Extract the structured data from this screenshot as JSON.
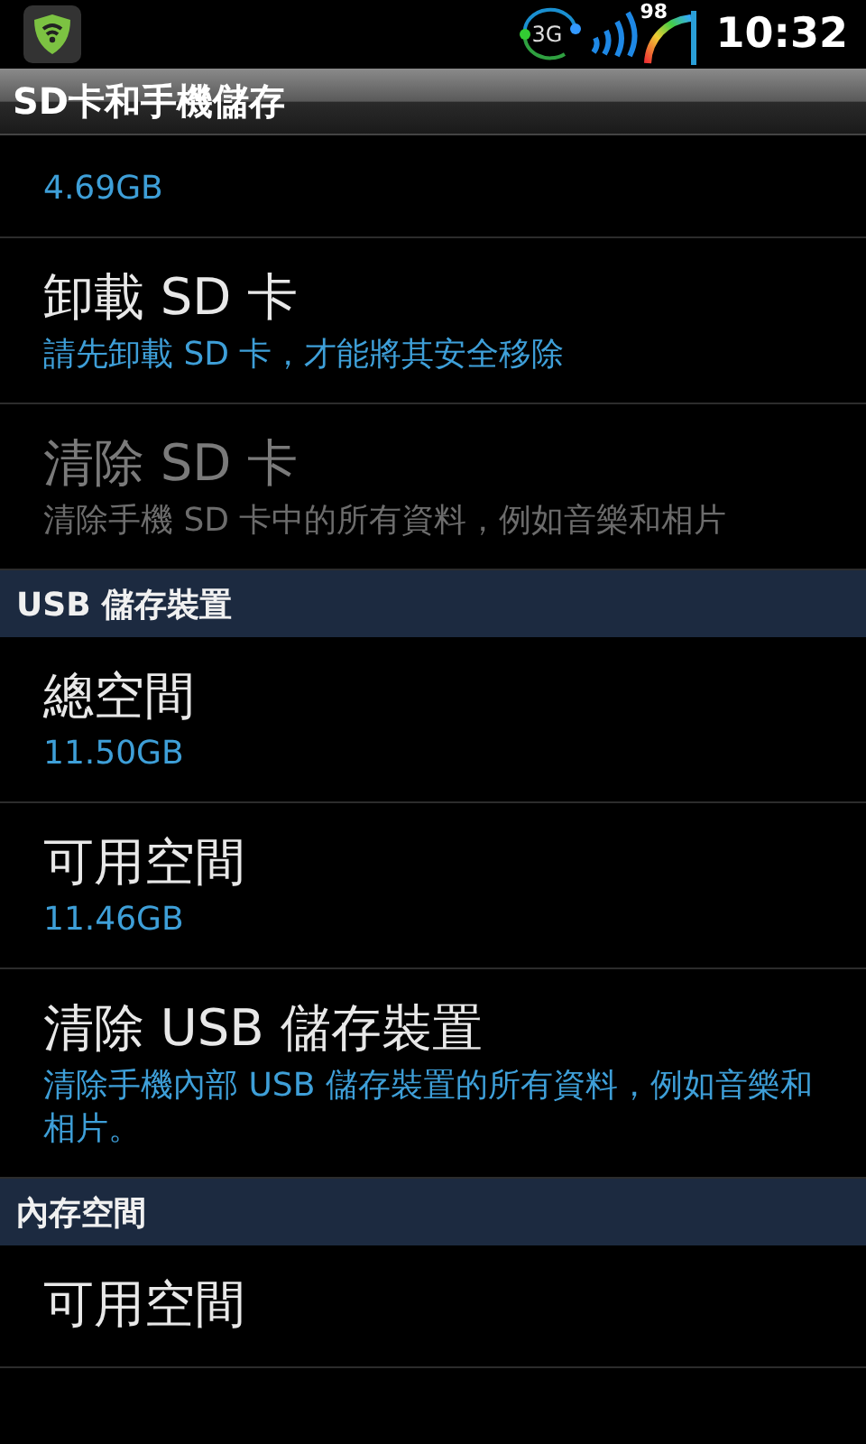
{
  "status_bar": {
    "network": "3G",
    "battery": "98",
    "time": "10:32"
  },
  "title_bar": {
    "title": "SD卡和手機儲存"
  },
  "list": [
    {
      "kind": "item",
      "summary": "4.69GB",
      "disabled": false
    },
    {
      "kind": "item",
      "title": "卸載 SD 卡",
      "summary": "請先卸載 SD 卡，才能將其安全移除",
      "disabled": false
    },
    {
      "kind": "item",
      "title": "清除 SD 卡",
      "summary": "清除手機 SD 卡中的所有資料，例如音樂和相片",
      "disabled": true
    },
    {
      "kind": "header",
      "title": "USB 儲存裝置"
    },
    {
      "kind": "item",
      "title": "總空間",
      "summary": "11.50GB",
      "disabled": false
    },
    {
      "kind": "item",
      "title": "可用空間",
      "summary": "11.46GB",
      "disabled": false
    },
    {
      "kind": "item",
      "title": "清除 USB 儲存裝置",
      "summary": "清除手機內部 USB 儲存裝置的所有資料，例如音樂和相片。",
      "disabled": false
    },
    {
      "kind": "header",
      "title": "內存空間"
    },
    {
      "kind": "item",
      "title": "可用空間",
      "disabled": false
    }
  ]
}
